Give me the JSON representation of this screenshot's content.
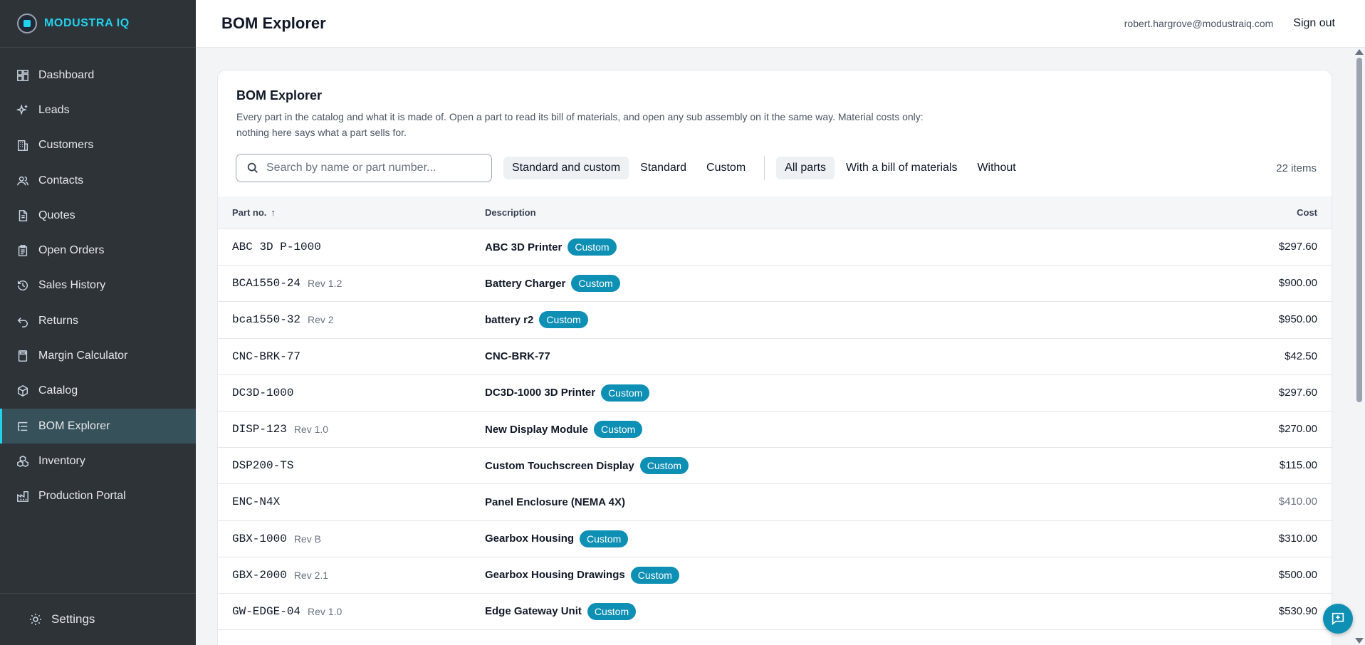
{
  "brand": {
    "name": "MODUSTRA IQ",
    "accent": "#22d3ee"
  },
  "sidebar": {
    "items": [
      {
        "label": "Dashboard",
        "icon": "dashboard-icon"
      },
      {
        "label": "Leads",
        "icon": "sparkle-icon"
      },
      {
        "label": "Customers",
        "icon": "building-icon"
      },
      {
        "label": "Contacts",
        "icon": "users-icon"
      },
      {
        "label": "Quotes",
        "icon": "document-icon"
      },
      {
        "label": "Open Orders",
        "icon": "clipboard-icon"
      },
      {
        "label": "Sales History",
        "icon": "history-icon"
      },
      {
        "label": "Returns",
        "icon": "undo-icon"
      },
      {
        "label": "Margin Calculator",
        "icon": "calculator-icon"
      },
      {
        "label": "Catalog",
        "icon": "box-icon"
      },
      {
        "label": "BOM Explorer",
        "icon": "list-tree-icon",
        "active": true
      },
      {
        "label": "Inventory",
        "icon": "boxes-icon"
      },
      {
        "label": "Production Portal",
        "icon": "factory-icon"
      }
    ],
    "settings_label": "Settings"
  },
  "topbar": {
    "title": "BOM Explorer",
    "email": "robert.hargrove@modustraiq.com",
    "signout": "Sign out"
  },
  "card": {
    "title": "BOM Explorer",
    "description": "Every part in the catalog and what it is made of. Open a part to read its bill of materials, and open any sub assembly on it the same way. Material costs only: nothing here says what a part sells for."
  },
  "filters": {
    "search_placeholder": "Search by name or part number...",
    "type_options": [
      "Standard and custom",
      "Standard",
      "Custom"
    ],
    "type_selected": "Standard and custom",
    "bom_options": [
      "All parts",
      "With a bill of materials",
      "Without"
    ],
    "bom_selected": "All parts",
    "count": "22 items"
  },
  "table": {
    "headers": {
      "part": "Part no.",
      "sort": "↑",
      "description": "Description",
      "cost": "Cost"
    },
    "rows": [
      {
        "part": "ABC 3D P-1000",
        "rev": "",
        "description": "ABC 3D Printer",
        "badge": "Custom",
        "cost": "$297.60"
      },
      {
        "part": "BCA1550-24",
        "rev": "Rev 1.2",
        "description": "Battery Charger",
        "badge": "Custom",
        "cost": "$900.00"
      },
      {
        "part": "bca1550-32",
        "rev": "Rev 2",
        "description": "battery r2",
        "badge": "Custom",
        "cost": "$950.00"
      },
      {
        "part": "CNC-BRK-77",
        "rev": "",
        "description": "CNC-BRK-77",
        "badge": "",
        "cost": "$42.50"
      },
      {
        "part": "DC3D-1000",
        "rev": "",
        "description": "DC3D-1000 3D Printer",
        "badge": "Custom",
        "cost": "$297.60"
      },
      {
        "part": "DISP-123",
        "rev": "Rev 1.0",
        "description": "New Display Module",
        "badge": "Custom",
        "cost": "$270.00"
      },
      {
        "part": "DSP200-TS",
        "rev": "",
        "description": "Custom Touchscreen Display",
        "badge": "Custom",
        "cost": "$115.00"
      },
      {
        "part": "ENC-N4X",
        "rev": "",
        "description": "Panel Enclosure (NEMA 4X)",
        "badge": "",
        "cost": "$410.00",
        "muted": true
      },
      {
        "part": "GBX-1000",
        "rev": "Rev B",
        "description": "Gearbox Housing",
        "badge": "Custom",
        "cost": "$310.00"
      },
      {
        "part": "GBX-2000",
        "rev": "Rev 2.1",
        "description": "Gearbox Housing Drawings",
        "badge": "Custom",
        "cost": "$500.00"
      },
      {
        "part": "GW-EDGE-04",
        "rev": "Rev 1.0",
        "description": "Edge Gateway Unit",
        "badge": "Custom",
        "cost": "$530.90"
      }
    ]
  },
  "colors": {
    "sidebar_bg": "#2e3338",
    "active_bg": "#36515a",
    "badge": "#0e8fb4"
  }
}
